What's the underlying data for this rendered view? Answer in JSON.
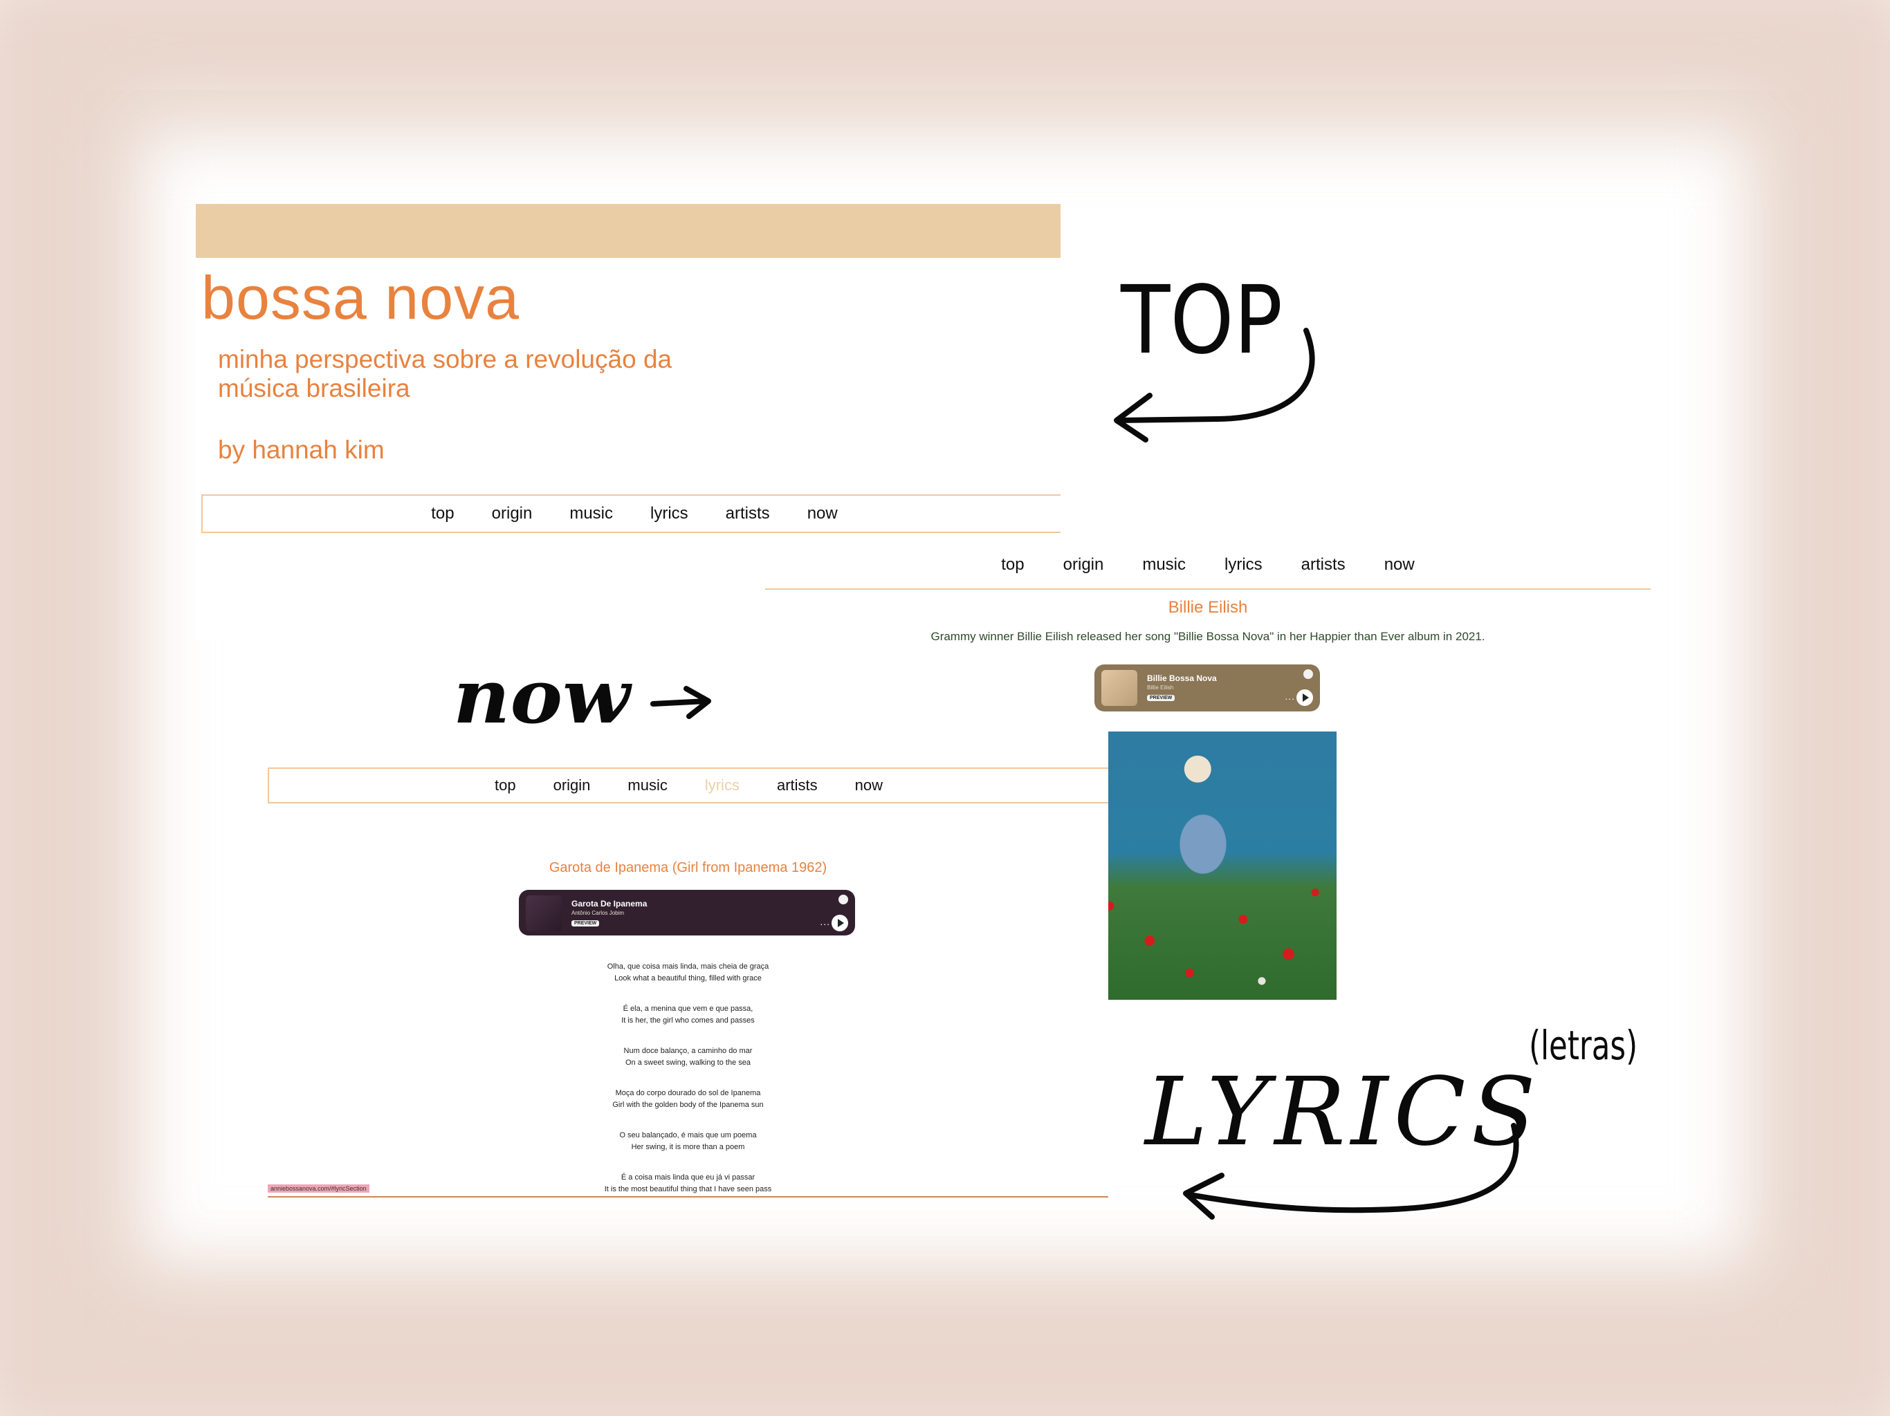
{
  "top_section": {
    "title": "bossa nova",
    "tagline": "minha perspectiva sobre a revolução da música brasileira",
    "byline": "by hannah kim",
    "nav": [
      "top",
      "origin",
      "music",
      "lyrics",
      "artists",
      "now"
    ],
    "banner_color": "#eacda4"
  },
  "now_section": {
    "nav": [
      "top",
      "origin",
      "music",
      "lyrics",
      "artists",
      "now"
    ],
    "heading": "Billie Eilish",
    "description": "Grammy winner Billie Eilish released her song \"Billie Bossa Nova\" in her Happier than Ever album in 2021.",
    "player": {
      "track": "Billie Bossa Nova",
      "artist": "Billie Eilish",
      "badge": "PREVIEW",
      "dots": "...",
      "bg_color": "#8b7655"
    },
    "photo_icon": "billie-eilish-photo"
  },
  "lyrics_section": {
    "nav": [
      "top",
      "origin",
      "music",
      "lyrics",
      "artists",
      "now"
    ],
    "current_nav": "lyrics",
    "song_heading": "Garota de Ipanema (Girl from Ipanema 1962)",
    "player": {
      "track": "Garota De Ipanema",
      "artist": "Antônio Carlos Jobim",
      "badge": "PREVIEW",
      "dots": "...",
      "bg_color": "#33202f"
    },
    "verses": [
      {
        "pt": "Olha, que coisa mais linda, mais cheia de graça",
        "en": "Look what a beautiful thing, filled with grace"
      },
      {
        "pt": "É ela, a menina que vem e que passa,",
        "en": "It is her, the girl who comes and passes"
      },
      {
        "pt": "Num doce balanço, a caminho do mar",
        "en": "On a sweet swing, walking to the sea"
      },
      {
        "pt": "Moça do corpo dourado do sol de Ipanema",
        "en": "Girl with the golden body of the Ipanema sun"
      },
      {
        "pt": "O seu balançado, é mais que um poema",
        "en": "Her swing, it is more than a poem"
      },
      {
        "pt": "É a coisa mais linda que eu já vi passar",
        "en": "It is the most beautiful thing that I have seen pass"
      }
    ],
    "status_url": "anniebossanova.com/#lyricSection"
  },
  "annotations": {
    "top": "TOP",
    "now": "now",
    "lyrics": "LYRICS",
    "letras": "(letras)"
  },
  "colors": {
    "accent": "#e8823f",
    "nav_border": "#f0c79c",
    "frame": "#e9d6cc"
  }
}
